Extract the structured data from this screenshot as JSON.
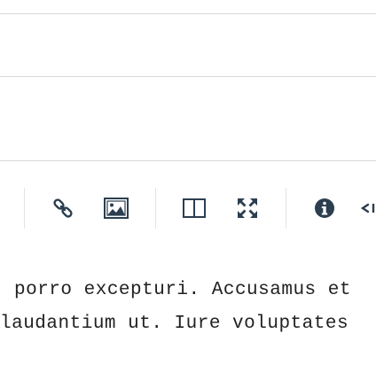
{
  "toolbar": {
    "buttons": [
      {
        "icon": "link-icon",
        "name": "link-button"
      },
      {
        "icon": "image-icon",
        "name": "image-button"
      },
      {
        "icon": "side-by-side-icon",
        "name": "side-by-side-button"
      },
      {
        "icon": "fullscreen-icon",
        "name": "fullscreen-button"
      },
      {
        "icon": "info-icon",
        "name": "guide-button"
      },
      {
        "icon": "partially-visible-icon",
        "name": "toolbar-button-partial"
      }
    ]
  },
  "editor": {
    "lines": [
      "porro excepturi. Accusamus et",
      "laudantium ut. Iure voluptates"
    ]
  }
}
